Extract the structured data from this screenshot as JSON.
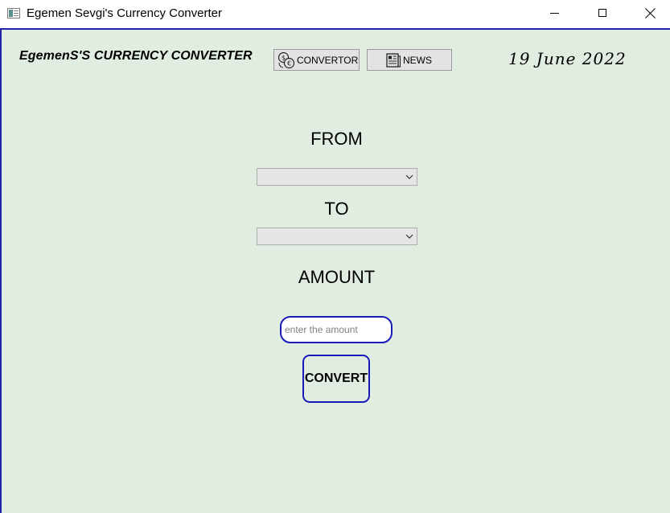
{
  "window": {
    "title": "Egemen Sevgi's Currency Converter",
    "icon": "app-window-icon",
    "controls": [
      "minimize-icon",
      "maximize-icon",
      "close-icon"
    ]
  },
  "header": {
    "brand": "EgemenS'S CURRENCY CONVERTER",
    "nav": {
      "convertor_label": "CONVERTOR",
      "convertor_icon": "currency-exchange-icon",
      "news_label": "NEWS",
      "news_icon": "newspaper-icon"
    },
    "date": "19 June 2022"
  },
  "form": {
    "from_label": "FROM",
    "from_value": "",
    "to_label": "TO",
    "to_value": "",
    "amount_label": "AMOUNT",
    "amount_placeholder": "enter the amount",
    "amount_value": "",
    "convert_label": "CONVERT"
  },
  "colors": {
    "background": "#e0ede0",
    "accent_border": "#1a1ab8"
  }
}
